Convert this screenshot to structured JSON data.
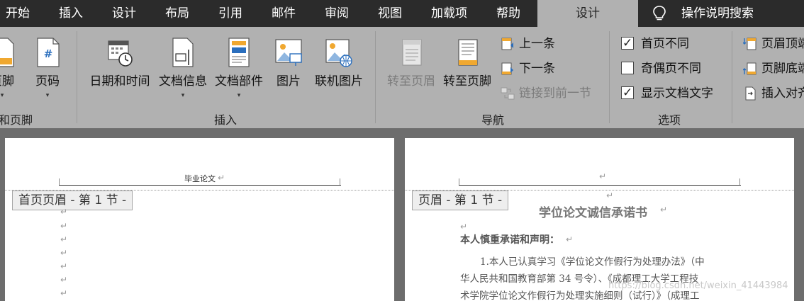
{
  "tabs": [
    "开始",
    "插入",
    "设计",
    "布局",
    "引用",
    "邮件",
    "审阅",
    "视图",
    "加载项",
    "帮助"
  ],
  "active_tab": "设计",
  "tell_me": "操作说明搜索",
  "ribbon": {
    "hf_group": {
      "footer_label": "页脚",
      "page_number_label": "页码",
      "group_label": "和页脚"
    },
    "insert_group": {
      "items": [
        "日期和时间",
        "文档信息",
        "文档部件",
        "图片",
        "联机图片"
      ],
      "group_label": "插入"
    },
    "nav_group": {
      "goto_header": "转至页眉",
      "goto_footer": "转至页脚",
      "previous": "上一条",
      "next": "下一条",
      "link_previous": "链接到前一节",
      "group_label": "导航"
    },
    "options_group": {
      "first_page_diff": "首页不同",
      "odd_even_diff": "奇偶页不同",
      "show_doc_text": "显示文档文字",
      "group_label": "选项",
      "first_page_checked": true,
      "odd_even_checked": false,
      "show_doc_text_checked": true
    },
    "position_group": {
      "header_top": "页眉顶端",
      "footer_bottom": "页脚底端",
      "insert_align": "插入对齐"
    }
  },
  "pages": {
    "left": {
      "header_text": "毕业论文",
      "header_tag": "首页页眉 - 第 1 节 -"
    },
    "right": {
      "header_tag": "页眉 - 第 1 节 -",
      "title": "学位论文诚信承诺书",
      "promise_heading": "本人慎重承诺和声明：",
      "lines": [
        "1.本人已认真学习《学位论文作假行为处理办法》（中",
        "华人民共和国教育部第 34 号令）、《成都理工大学工程技",
        "术学院学位论文作假行为处理实施细则（试行）》（成理工"
      ]
    }
  },
  "watermark": "https://blog.csdn.net/weixin_41443984",
  "paragraph_mark": "↵",
  "checkmark": "✓",
  "caret": "▾"
}
